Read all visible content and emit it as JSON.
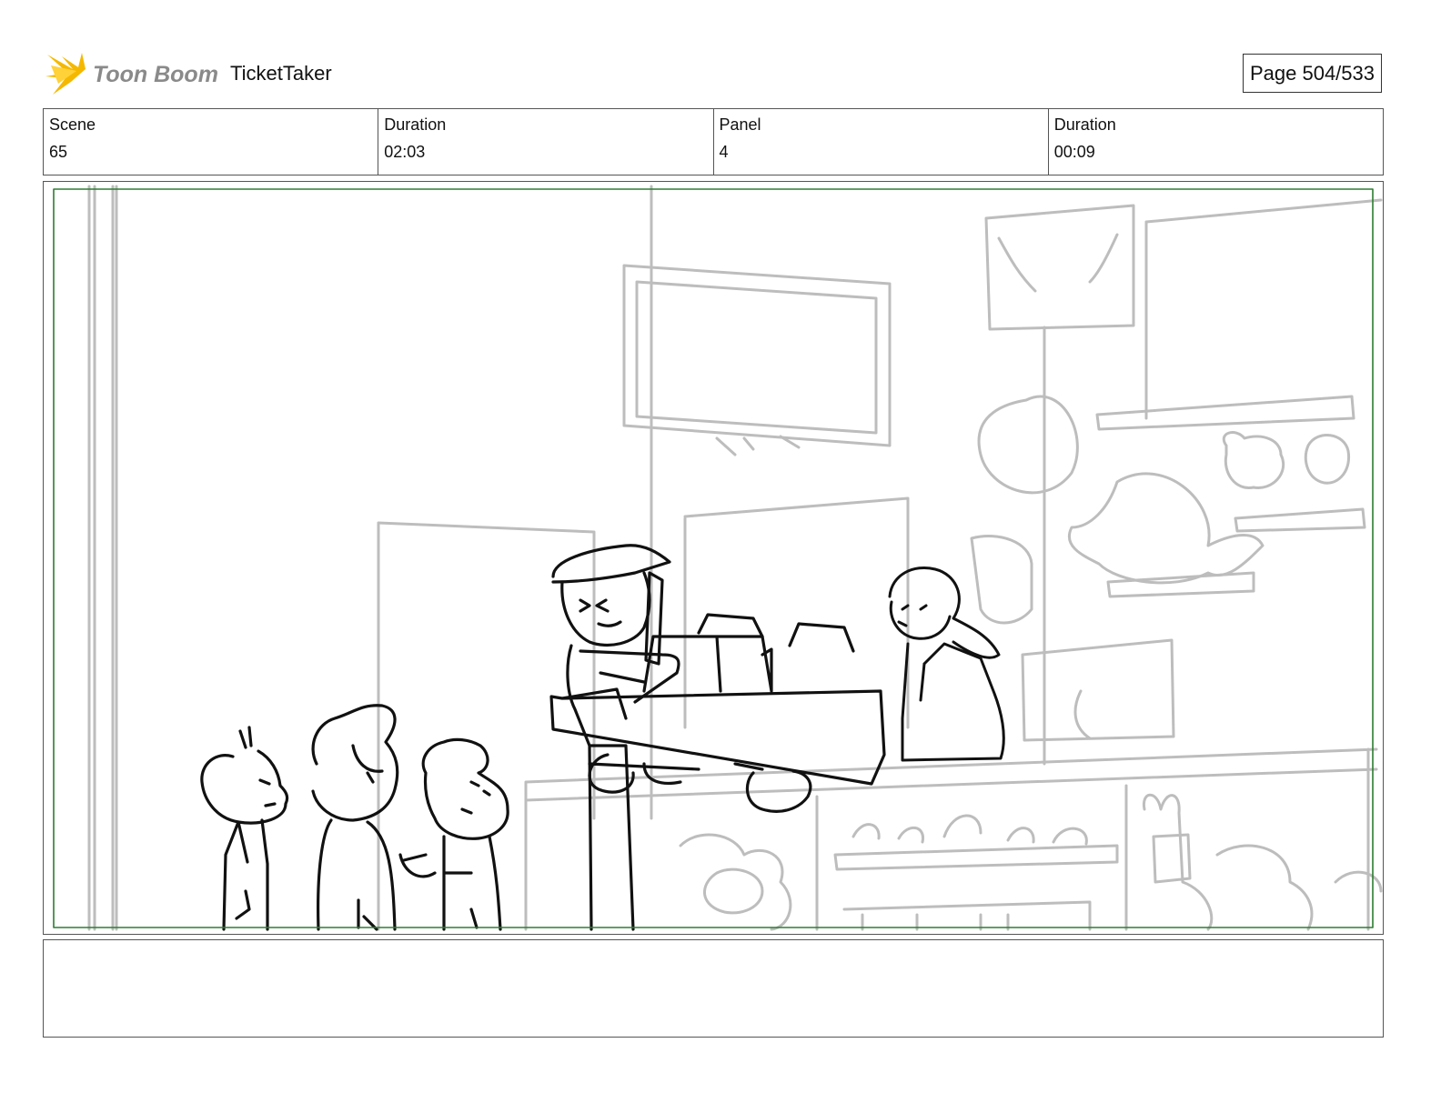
{
  "header": {
    "logo_text": "Toon Boom",
    "project_title": "TicketTaker",
    "page_label": "Page 504/533"
  },
  "info": [
    {
      "label": "Scene",
      "value": "65"
    },
    {
      "label": "Duration",
      "value": "02:03"
    },
    {
      "label": "Panel",
      "value": "4"
    },
    {
      "label": "Duration",
      "value": "00:09"
    }
  ],
  "panel": {
    "safe_frame_color": "#2e7d32",
    "sketch_line_color": "#111111",
    "background_line_color": "#bdbdbd"
  },
  "notes": {
    "text": ""
  }
}
